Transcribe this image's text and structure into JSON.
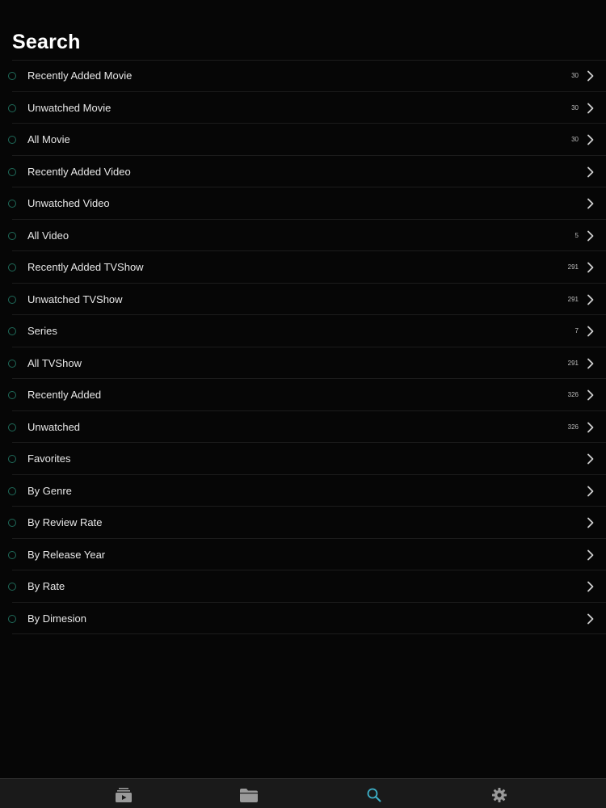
{
  "header": {
    "title": "Search"
  },
  "colors": {
    "accent": "#3db0c8",
    "row_dot": "#1f6b5a",
    "tab_inactive": "#9a9a9a"
  },
  "list": [
    {
      "label": "Recently Added Movie",
      "count": "30"
    },
    {
      "label": "Unwatched Movie",
      "count": "30"
    },
    {
      "label": "All Movie",
      "count": "30"
    },
    {
      "label": "Recently Added Video",
      "count": ""
    },
    {
      "label": "Unwatched Video",
      "count": ""
    },
    {
      "label": "All Video",
      "count": "5"
    },
    {
      "label": "Recently Added TVShow",
      "count": "291"
    },
    {
      "label": "Unwatched TVShow",
      "count": "291"
    },
    {
      "label": "Series",
      "count": "7"
    },
    {
      "label": "All TVShow",
      "count": "291"
    },
    {
      "label": "Recently Added",
      "count": "326"
    },
    {
      "label": "Unwatched",
      "count": "326"
    },
    {
      "label": "Favorites",
      "count": ""
    },
    {
      "label": "By Genre",
      "count": ""
    },
    {
      "label": "By Review Rate",
      "count": ""
    },
    {
      "label": "By Release Year",
      "count": ""
    },
    {
      "label": "By Rate",
      "count": ""
    },
    {
      "label": "By Dimesion",
      "count": ""
    }
  ],
  "tabbar": {
    "tabs": [
      {
        "icon": "media-library-icon",
        "selected": false
      },
      {
        "icon": "folder-icon",
        "selected": false
      },
      {
        "icon": "search-icon",
        "selected": true
      },
      {
        "icon": "gear-icon",
        "selected": false
      }
    ]
  }
}
